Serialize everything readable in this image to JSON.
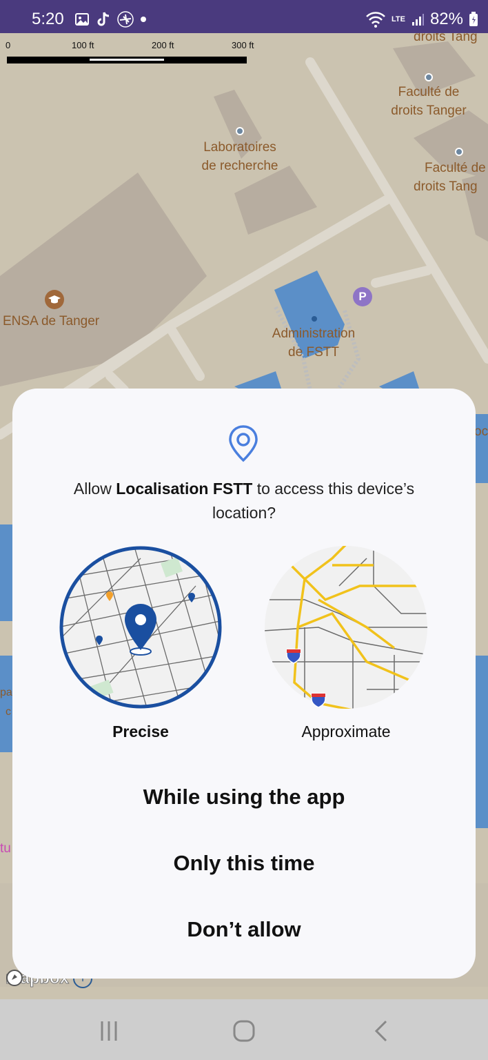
{
  "status_bar": {
    "time": "5:20",
    "battery": "82%",
    "network_label": "LTE",
    "icons": [
      "gallery-icon",
      "tiktok-icon",
      "airplane-icon",
      "dot-icon",
      "wifi-icon",
      "signal-icon",
      "battery-icon"
    ]
  },
  "map": {
    "scale": {
      "labels": [
        "0",
        "100 ft",
        "200 ft",
        "300 ft"
      ]
    },
    "labels": {
      "faculte_top_partial": "droits Tang",
      "faculte_1": [
        "Faculté de",
        "droits Tanger"
      ],
      "faculte_2": [
        "Faculté de",
        "droits Tang"
      ],
      "laboratoires": [
        "Laboratoires",
        "de recherche"
      ],
      "ensa": "ENSA de Tanger",
      "administration": [
        "Administration",
        "de FSTT"
      ],
      "parking": "P",
      "partial_right": "oc",
      "partial_left_1": "pa",
      "partial_left_2": "c",
      "partial_left_3": "tu"
    },
    "attribution": "mapbox",
    "info_icon": "i"
  },
  "dialog": {
    "message_prefix": "Allow ",
    "app_name": "Localisation FSTT",
    "message_suffix": " to access this device’s location?",
    "options": {
      "precise": "Precise",
      "approximate": "Approximate"
    },
    "actions": {
      "while_using": "While using the app",
      "only_this_time": "Only this time",
      "dont_allow": "Don’t allow"
    }
  },
  "colors": {
    "status_bar": "#4a3a7e",
    "map_bg": "#cbc3b0",
    "building_blue": "#5b8fc8",
    "label_brown": "#8b5a2b",
    "accent_blue": "#1a4fa0",
    "dialog_bg": "#f8f8fb"
  }
}
